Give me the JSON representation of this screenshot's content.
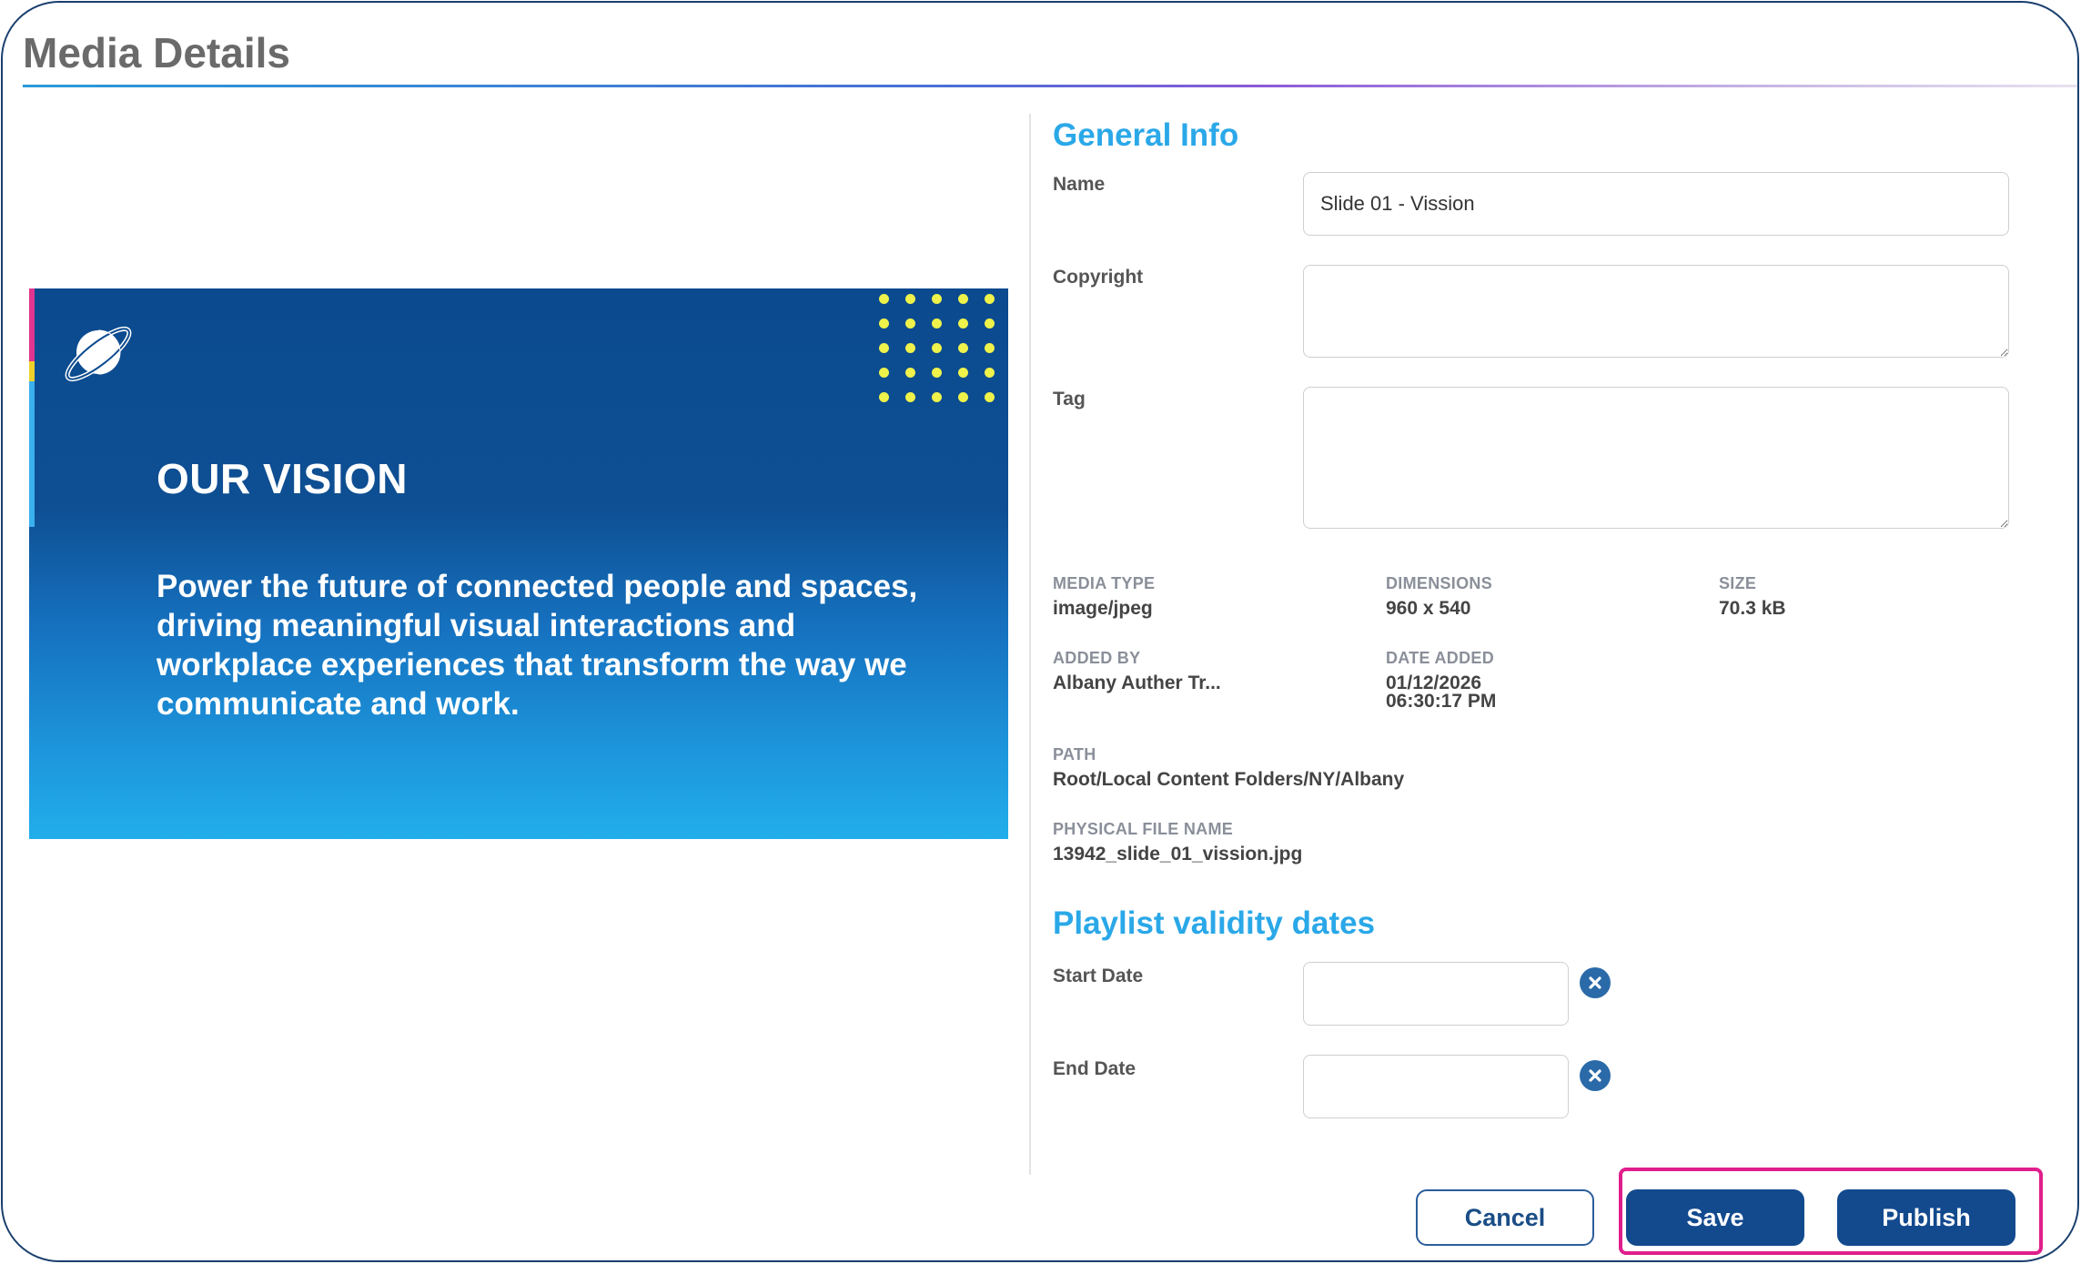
{
  "header": {
    "title": "Media Details"
  },
  "preview": {
    "heading": "OUR VISION",
    "body": "Power the future of connected people and spaces, driving meaningful visual interactions and workplace experiences that transform the way we communicate and work.",
    "logo_icon": "planet-icon",
    "colors": {
      "top": "#0b4a8e",
      "bottom": "#22aeeb",
      "dots": "#eef24a"
    }
  },
  "general_info": {
    "title": "General Info",
    "name_label": "Name",
    "name_value": "Slide 01 - Vission",
    "copyright_label": "Copyright",
    "copyright_value": "",
    "tag_label": "Tag",
    "tag_value": ""
  },
  "metadata": {
    "media_type_label": "MEDIA TYPE",
    "media_type_value": "image/jpeg",
    "dimensions_label": "DIMENSIONS",
    "dimensions_value": "960 x 540",
    "size_label": "SIZE",
    "size_value": "70.3 kB",
    "added_by_label": "ADDED BY",
    "added_by_value": "Albany Auther Tr...",
    "date_added_label": "DATE ADDED",
    "date_added_date": "01/12/2026",
    "date_added_time": "06:30:17 PM",
    "path_label": "PATH",
    "path_value": "Root/Local Content Folders/NY/Albany",
    "physical_file_label": "PHYSICAL FILE NAME",
    "physical_file_value": "13942_slide_01_vission.jpg"
  },
  "playlist": {
    "title": "Playlist validity dates",
    "start_label": "Start Date",
    "start_value": "",
    "end_label": "End Date",
    "end_value": "",
    "clear_icon": "clear-x-icon"
  },
  "actions": {
    "cancel": "Cancel",
    "save": "Save",
    "publish": "Publish",
    "primary_color": "#134a8e",
    "highlight_color": "#e01e8c"
  }
}
